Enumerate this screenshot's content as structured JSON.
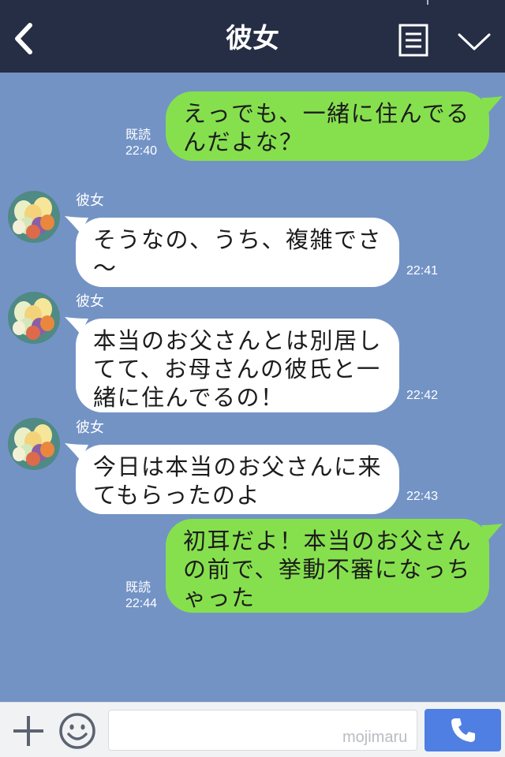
{
  "header": {
    "title": "彼女",
    "back_icon": "chevron-left-icon",
    "menu_icon": "notes-icon",
    "collapse_icon": "chevron-down-icon",
    "background": "#252e45"
  },
  "colors": {
    "chat_background": "#7393c5",
    "my_bubble": "#86e04e",
    "their_bubble": "#ffffff",
    "send_button": "#4f7fe3"
  },
  "messages": [
    {
      "from": "me",
      "text": "えっでも、一緒に住んでる\nんだよな？",
      "read_label": "既読",
      "time": "22:40"
    },
    {
      "from": "her",
      "sender": "彼女",
      "text": "そうなの、うち、複雑でさ\n〜",
      "time": "22:41"
    },
    {
      "from": "her",
      "sender": "彼女",
      "text": "本当のお父さんとは別居し\nてて、お母さんの彼氏と一\n緒に住んでるの！",
      "time": "22:42"
    },
    {
      "from": "her",
      "sender": "彼女",
      "text": "今日は本当のお父さんに来\nてもらったのよ",
      "time": "22:43"
    },
    {
      "from": "me",
      "text": "初耳だよ！本当のお父さん\nの前で、挙動不審になっち\nゃった",
      "read_label": "既読",
      "time": "22:44"
    }
  ],
  "input_bar": {
    "placeholder": "",
    "watermark": "mojimaru",
    "plus_icon": "plus-icon",
    "emoji_icon": "smiley-icon",
    "call_icon": "phone-icon"
  }
}
